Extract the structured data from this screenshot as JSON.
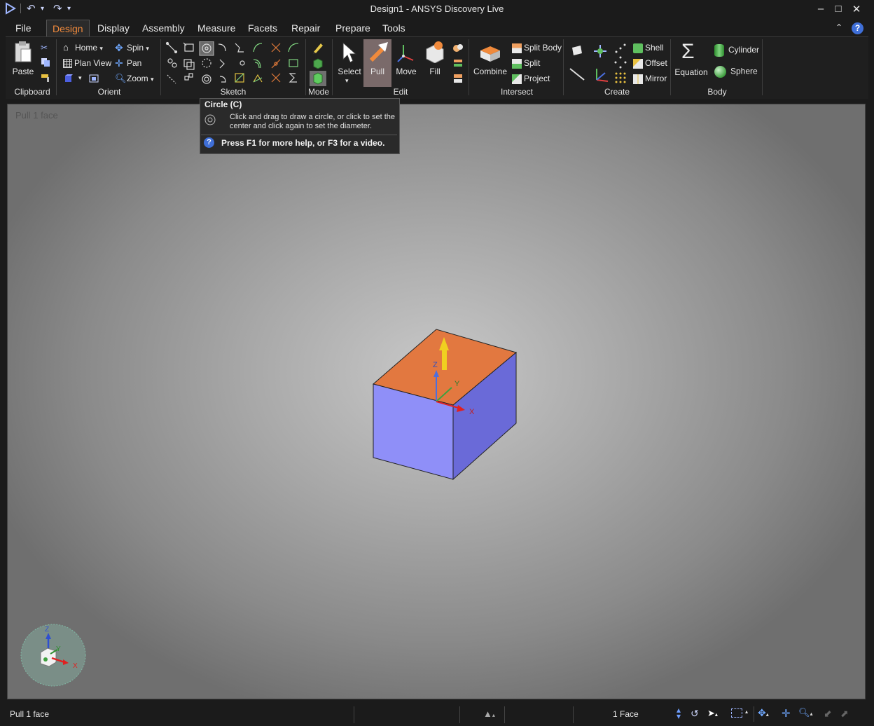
{
  "window": {
    "title": "Design1 - ANSYS Discovery Live"
  },
  "menu": {
    "items": [
      "File",
      "Design",
      "Display",
      "Assembly",
      "Measure",
      "Facets",
      "Repair",
      "Prepare",
      "Tools"
    ],
    "active": "Design"
  },
  "ribbon": {
    "clipboard": {
      "paste": "Paste",
      "label": "Clipboard"
    },
    "orient": {
      "home": "Home",
      "plan_view": "Plan View",
      "spin": "Spin",
      "pan": "Pan",
      "zoom": "Zoom",
      "label": "Orient"
    },
    "sketch": {
      "label": "Sketch"
    },
    "mode": {
      "label": "Mode"
    },
    "edit": {
      "select": "Select",
      "pull": "Pull",
      "move": "Move",
      "fill": "Fill",
      "label": "Edit"
    },
    "intersect": {
      "combine": "Combine",
      "split_body": "Split Body",
      "split": "Split",
      "project": "Project",
      "label": "Intersect"
    },
    "create": {
      "shell": "Shell",
      "offset": "Offset",
      "mirror": "Mirror",
      "label": "Create"
    },
    "body": {
      "equation": "Equation",
      "cylinder": "Cylinder",
      "sphere": "Sphere",
      "label": "Body"
    }
  },
  "tooltip": {
    "title": "Circle (C)",
    "line1": "Click and drag to draw a circle, or click to set the",
    "line2": "center and click again to set the diameter.",
    "help": "Press F1 for more help, or F3 for a video."
  },
  "viewport": {
    "label": "Pull 1 face",
    "axis_x": "X",
    "axis_y": "Y",
    "axis_z": "Z"
  },
  "status": {
    "left": "Pull 1 face",
    "selection": "1 Face"
  },
  "colors": {
    "accent": "#f08a3c",
    "box_top": "#e27840",
    "box_front": "#8f8ff8",
    "box_side": "#6a6ad8"
  }
}
